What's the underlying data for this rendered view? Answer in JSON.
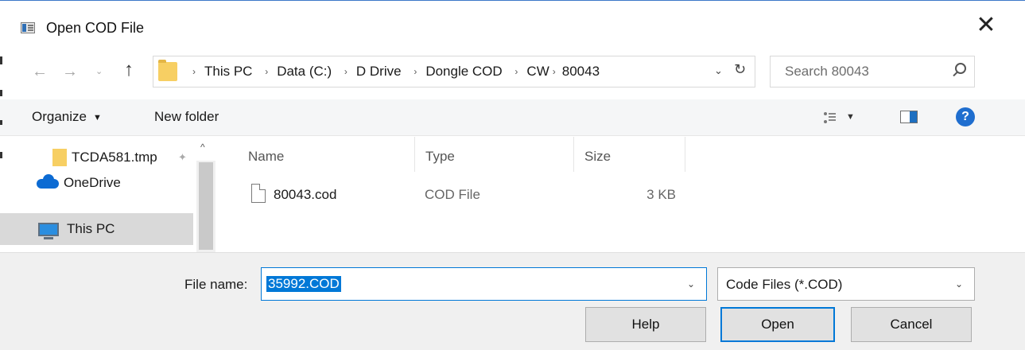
{
  "window": {
    "title": "Open COD File"
  },
  "address": {
    "breadcrumbs": [
      "This PC",
      "Data (C:)",
      "D Drive",
      "Dongle COD",
      "CW",
      "80043"
    ]
  },
  "search": {
    "placeholder": "Search 80043"
  },
  "toolbar": {
    "organize_label": "Organize",
    "new_folder_label": "New folder"
  },
  "nav_pane": {
    "items": [
      {
        "label": "TCDA581.tmp"
      },
      {
        "label": "OneDrive"
      },
      {
        "label": "This PC",
        "selected": true
      }
    ]
  },
  "file_list": {
    "columns": [
      "Name",
      "Type",
      "Size"
    ],
    "rows": [
      {
        "name": "80043.cod",
        "type": "COD File",
        "size": "3 KB"
      }
    ]
  },
  "bottom": {
    "file_name_label": "File name:",
    "file_name_value": "35992.COD",
    "file_type_value": "Code Files (*.COD)",
    "help_label": "Help",
    "open_label": "Open",
    "cancel_label": "Cancel"
  },
  "colors": {
    "accent": "#0078d7",
    "selected_row": "#d9d9d9",
    "bottom_bg": "#f0f0f0"
  },
  "icons": {
    "app": "app-window-icon",
    "close": "close-icon",
    "back": "arrow-left-icon",
    "forward": "arrow-right-icon",
    "up": "arrow-up-icon",
    "refresh": "refresh-icon",
    "search": "search-icon",
    "help": "help-icon"
  }
}
